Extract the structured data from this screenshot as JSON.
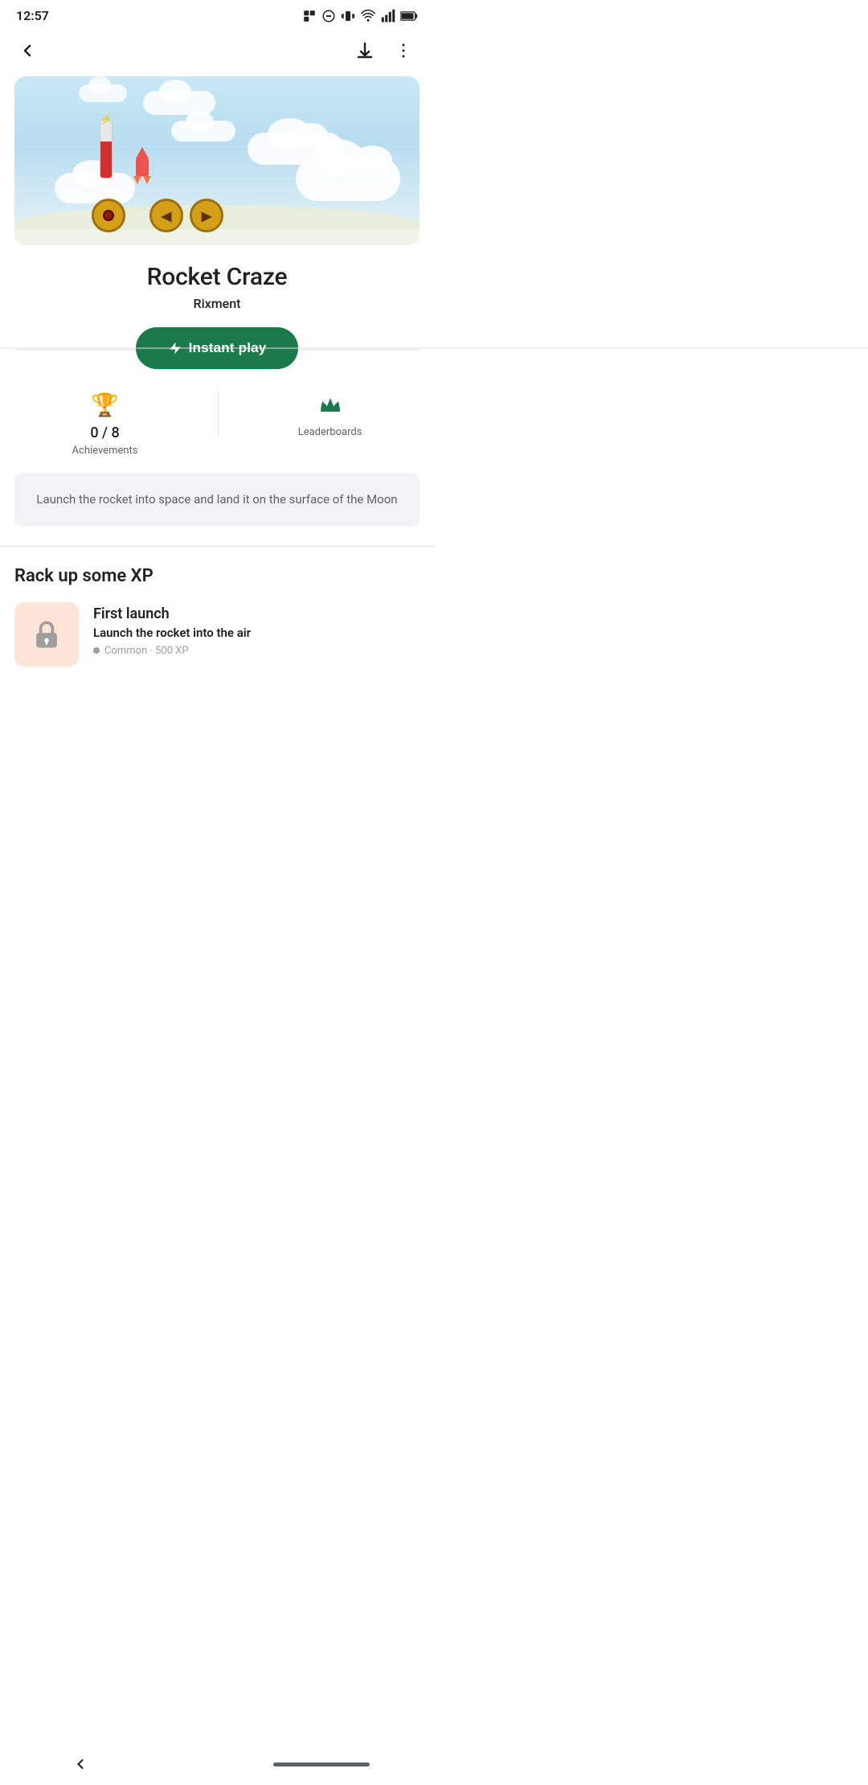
{
  "status": {
    "time": "12:57",
    "icons": [
      "notification-icon",
      "dnd-icon",
      "vibrate-icon",
      "wifi-icon",
      "signal-icon",
      "battery-icon"
    ]
  },
  "nav": {
    "back_label": "←",
    "download_label": "⬇",
    "more_label": "⋮"
  },
  "game": {
    "title": "Rocket Craze",
    "developer": "Rixment",
    "instant_play_label": "Instant play",
    "achievements_value": "0 / 8",
    "achievements_label": "Achievements",
    "leaderboards_label": "Leaderboards",
    "description": "Launch the rocket into space and land it on the surface of the Moon"
  },
  "xp_section": {
    "title": "Rack up some XP",
    "items": [
      {
        "id": "first-launch",
        "title": "First launch",
        "description": "Launch the rocket into the air",
        "meta": "Common · 500 XP"
      }
    ]
  },
  "bottom_nav": {
    "back_label": "<"
  }
}
